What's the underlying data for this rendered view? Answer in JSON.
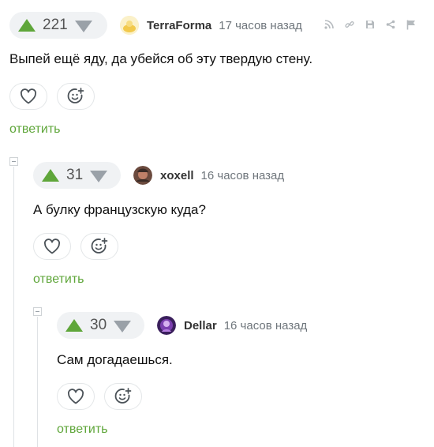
{
  "colors": {
    "accent": "#5fa63a",
    "upvote": "#5fa63a",
    "downvote": "#9aa1a8",
    "muted": "#6f767c"
  },
  "comments": [
    {
      "rating": "221",
      "author": "TerraForma",
      "time": "17 часов назад",
      "text": "Выпей ещё яду, да убейся об эту твердую стену.",
      "reply_label": "ответить",
      "tools": [
        "rss-icon",
        "link-icon",
        "save-icon",
        "share-icon",
        "flag-icon"
      ]
    },
    {
      "rating": "31",
      "author": "xoxell",
      "time": "16 часов назад",
      "text": "А булку французскую куда?",
      "reply_label": "ответить"
    },
    {
      "rating": "30",
      "author": "Dellar",
      "time": "16 часов назад",
      "text": "Сам догадаешься.",
      "reply_label": "ответить"
    }
  ]
}
